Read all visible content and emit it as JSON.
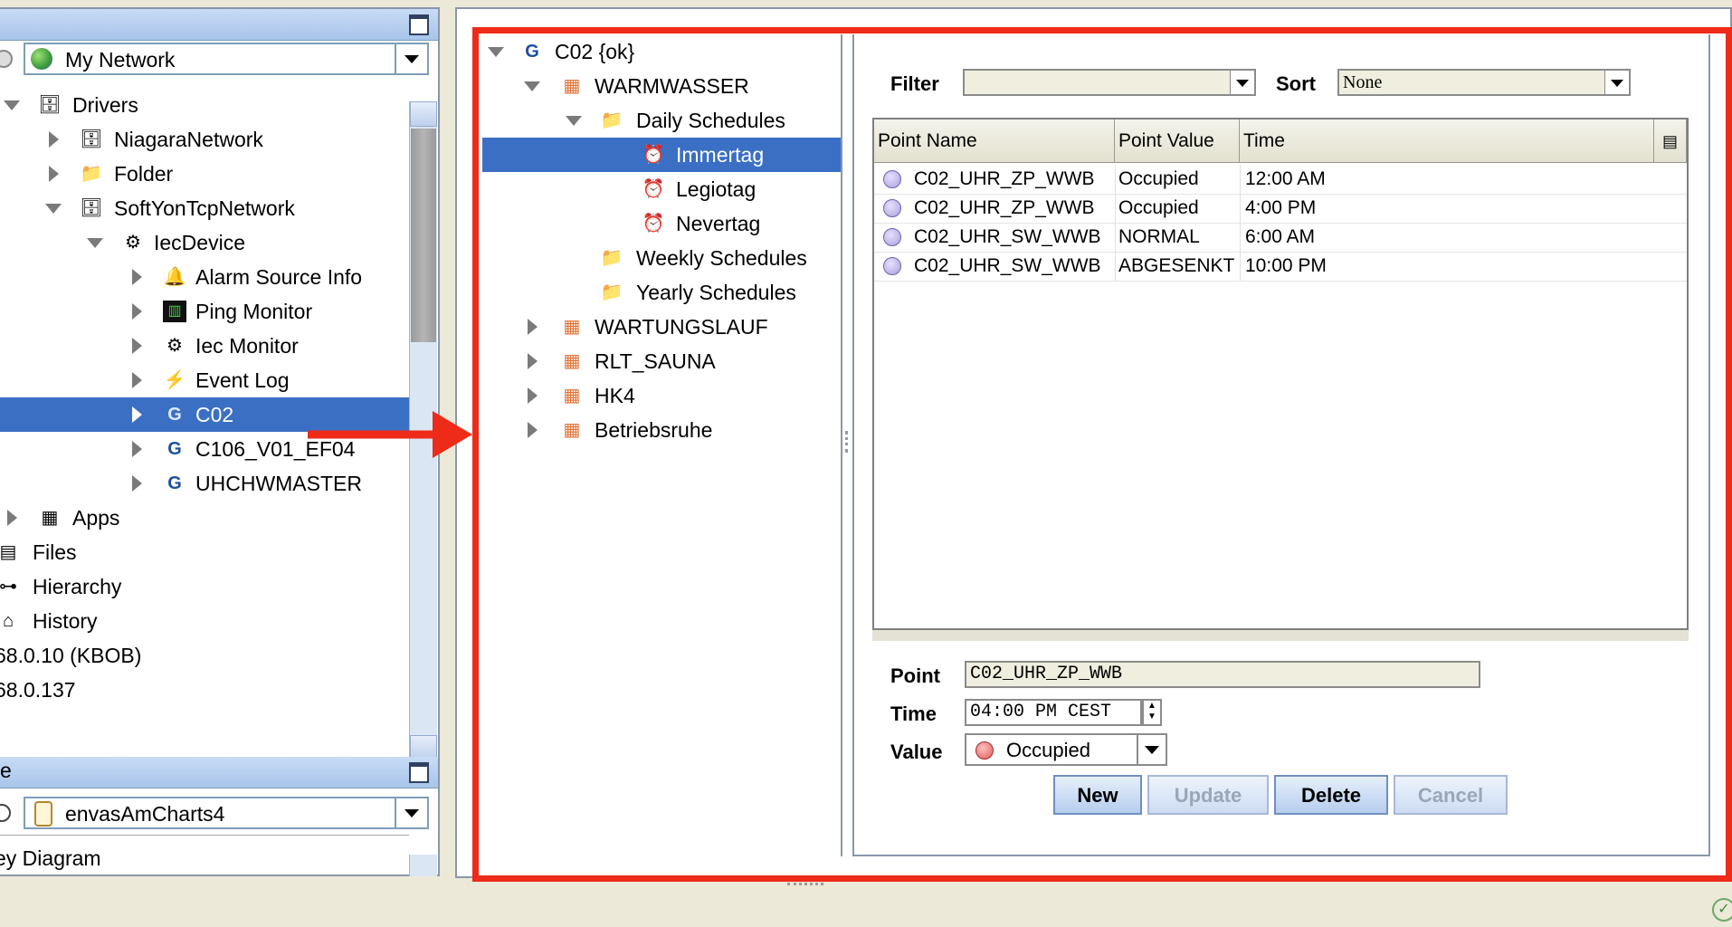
{
  "nav": {
    "network_combo": "My Network",
    "tree": [
      {
        "label": "Drivers"
      },
      {
        "label": "NiagaraNetwork"
      },
      {
        "label": "Folder"
      },
      {
        "label": "SoftYonTcpNetwork"
      },
      {
        "label": "IecDevice"
      },
      {
        "label": "Alarm Source Info"
      },
      {
        "label": "Ping Monitor"
      },
      {
        "label": "Iec Monitor"
      },
      {
        "label": "Event Log"
      },
      {
        "label": "C02"
      },
      {
        "label": "C106_V01_EF04"
      },
      {
        "label": "UHCHWMASTER"
      },
      {
        "label": "Apps"
      },
      {
        "label": "Files"
      },
      {
        "label": "Hierarchy"
      },
      {
        "label": "History"
      },
      {
        "label": "68.0.10 (KBOB)"
      },
      {
        "label": "68.0.137"
      }
    ],
    "bottom_head_label": "e",
    "bottom_combo": "envasAmCharts4",
    "bottom_partial_item": "ey Diagram"
  },
  "schedule_tree": [
    {
      "label": "C02 {ok}"
    },
    {
      "label": "WARMWASSER"
    },
    {
      "label": "Daily Schedules"
    },
    {
      "label": "Immertag"
    },
    {
      "label": "Legiotag"
    },
    {
      "label": "Nevertag"
    },
    {
      "label": "Weekly Schedules"
    },
    {
      "label": "Yearly Schedules"
    },
    {
      "label": "WARTUNGSLAUF"
    },
    {
      "label": "RLT_SAUNA"
    },
    {
      "label": "HK4"
    },
    {
      "label": "Betriebsruhe"
    }
  ],
  "detail": {
    "filter_label": "Filter",
    "filter_value": "",
    "sort_label": "Sort",
    "sort_value": "None",
    "columns": [
      "Point Name",
      "Point Value",
      "Time"
    ],
    "rows": [
      {
        "name": "C02_UHR_ZP_WWB",
        "value": "Occupied",
        "time": "12:00 AM"
      },
      {
        "name": "C02_UHR_ZP_WWB",
        "value": "Occupied",
        "time": "4:00 PM"
      },
      {
        "name": "C02_UHR_SW_WWB",
        "value": "NORMAL",
        "time": "6:00 AM"
      },
      {
        "name": "C02_UHR_SW_WWB",
        "value": "ABGESENKT",
        "time": "10:00 PM"
      }
    ],
    "point_label": "Point",
    "point_value": "C02_UHR_ZP_WWB",
    "time_label": "Time",
    "time_value": "04:00 PM CEST",
    "value_label": "Value",
    "value_value": "Occupied",
    "buttons": {
      "new": "New",
      "update": "Update",
      "delete": "Delete",
      "cancel": "Cancel"
    }
  },
  "colors": {
    "selection": "#3a6fc4",
    "annotation_red": "#ee2a18"
  }
}
